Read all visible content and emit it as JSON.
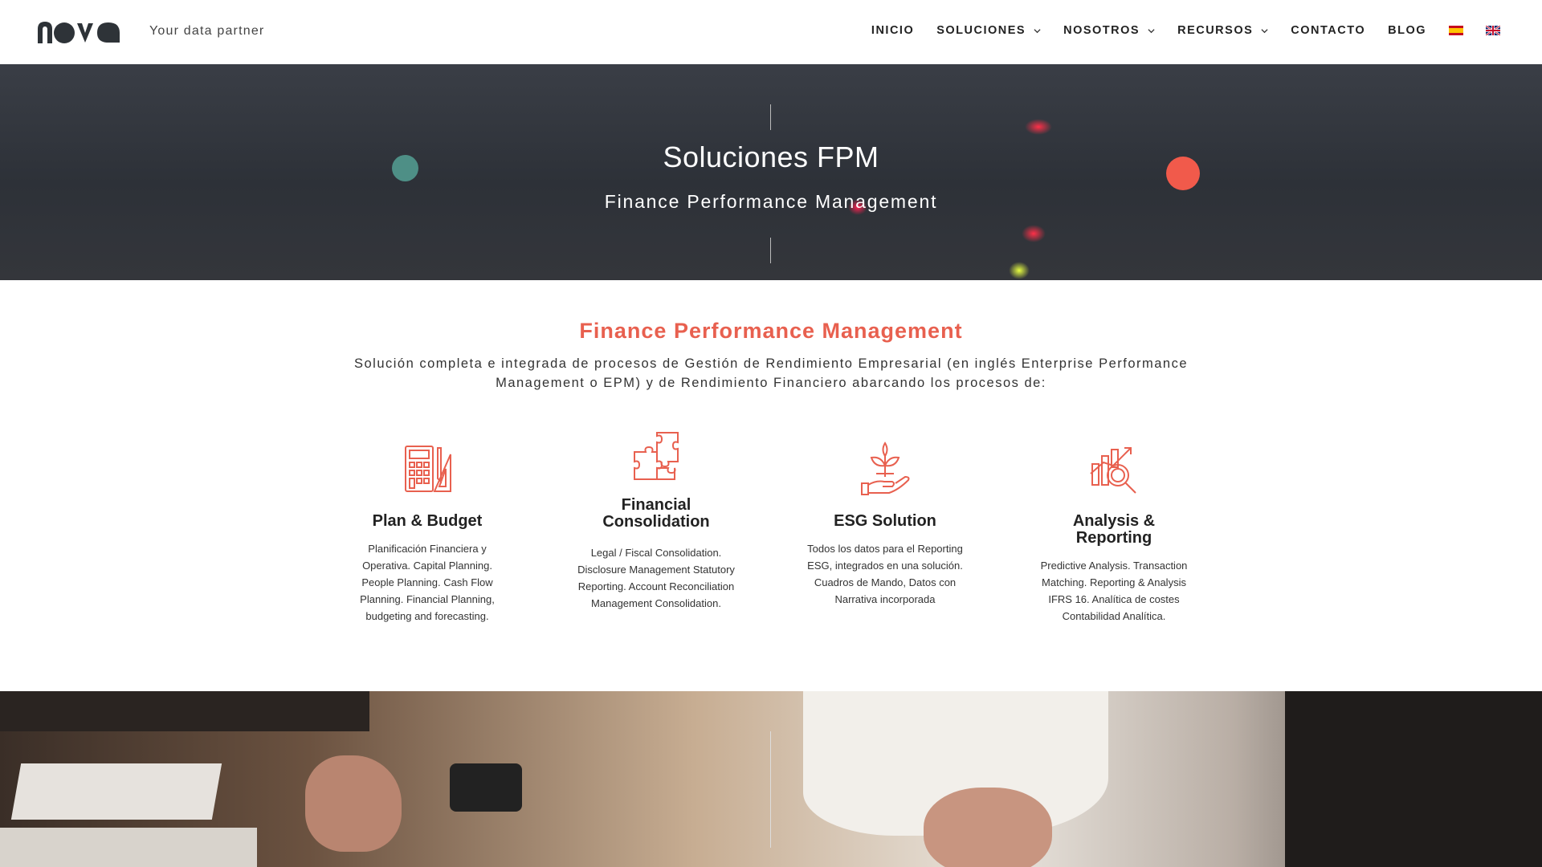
{
  "header": {
    "logo_icon": "nova-logo",
    "tagline": "Your data partner",
    "nav": [
      {
        "label": "INICIO",
        "dropdown": false
      },
      {
        "label": "SOLUCIONES",
        "dropdown": true
      },
      {
        "label": "NOSOTROS",
        "dropdown": true
      },
      {
        "label": "RECURSOS",
        "dropdown": true
      },
      {
        "label": "CONTACTO",
        "dropdown": false
      },
      {
        "label": "BLOG",
        "dropdown": false
      }
    ],
    "flags": [
      "spain-flag-icon",
      "uk-flag-icon"
    ]
  },
  "hero": {
    "title": "Soluciones FPM",
    "subtitle": "Finance Performance Management"
  },
  "intro": {
    "title": "Finance Performance Management",
    "text": "Solución completa e integrada de procesos de Gestión de Rendimiento Empresarial (en inglés Enterprise Performance Management o EPM) y de Rendimiento Financiero abarcando los procesos de:"
  },
  "cards": [
    {
      "icon": "calculator-ruler-icon",
      "title": "Plan & Budget",
      "desc": "Planificación Financiera y Operativa. Capital Planning. People Planning. Cash Flow Planning. Financial Planning, budgeting and forecasting."
    },
    {
      "icon": "puzzle-icon",
      "title": "Financial Consolidation",
      "desc": "Legal / Fiscal Consolidation. Disclosure Management Statutory Reporting. Account Reconciliation Management Consolidation."
    },
    {
      "icon": "plant-hand-icon",
      "title": "ESG Solution",
      "desc": "Todos los datos para el Reporting ESG, integrados en una solución. Cuadros de Mando, Datos con Narrativa incorporada"
    },
    {
      "icon": "chart-magnifier-icon",
      "title": "Analysis & Reporting",
      "desc": "Predictive Analysis. Transaction Matching. Reporting & Analysis IFRS 16. Analítica de costes Contabilidad Analítica."
    }
  ],
  "colors": {
    "accent": "#e8604f",
    "teal": "#4e8f86",
    "red_dot": "#f15a4b",
    "text": "#222222"
  }
}
